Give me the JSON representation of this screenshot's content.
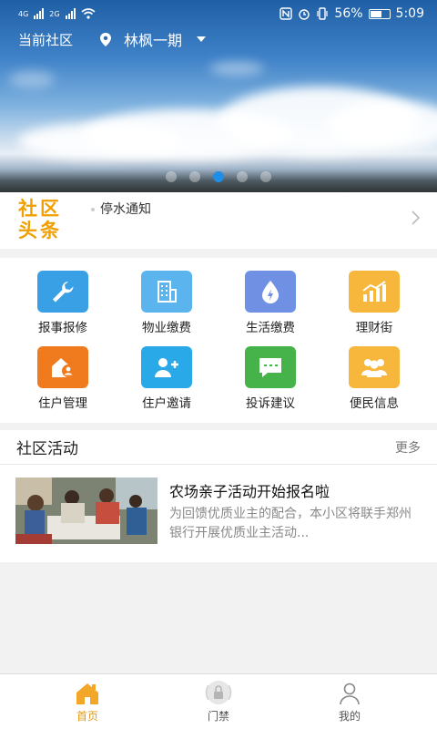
{
  "status_bar": {
    "network_left_1": "4G",
    "network_left_2": "2G",
    "battery_percent": "56%",
    "time": "5:09"
  },
  "header": {
    "community_label": "当前社区",
    "location": "林枫一期"
  },
  "banner": {
    "slide_count": 5,
    "active_slide": 3
  },
  "headline": {
    "logo_line1": "社区",
    "logo_line2": "头条",
    "notice": "停水通知"
  },
  "services": [
    {
      "label": "报事报修",
      "color": "#3aa0e6",
      "icon": "wrench-icon"
    },
    {
      "label": "物业缴费",
      "color": "#5cb4ee",
      "icon": "building-icon"
    },
    {
      "label": "生活缴费",
      "color": "#6f90e3",
      "icon": "utility-drop-icon"
    },
    {
      "label": "理财街",
      "color": "#f6b73c",
      "icon": "bar-chart-icon"
    },
    {
      "label": "住户管理",
      "color": "#f07a1e",
      "icon": "house-user-icon"
    },
    {
      "label": "住户邀请",
      "color": "#2aa9e8",
      "icon": "add-user-icon"
    },
    {
      "label": "投诉建议",
      "color": "#45b24a",
      "icon": "chat-icon"
    },
    {
      "label": "便民信息",
      "color": "#f6b73c",
      "icon": "people-icon"
    }
  ],
  "activity": {
    "section_title": "社区活动",
    "more_label": "更多",
    "item": {
      "title": "农场亲子活动开始报名啦",
      "description": "为回馈优质业主的配合，本小区将联手郑州银行开展优质业主活动..."
    }
  },
  "tabs": [
    {
      "label": "首页",
      "icon": "home-icon",
      "active": true
    },
    {
      "label": "门禁",
      "icon": "lock-icon",
      "active": false
    },
    {
      "label": "我的",
      "icon": "profile-icon",
      "active": false
    }
  ],
  "colors": {
    "accent": "#e39b15",
    "banner_dot_active": "#1e8ee6",
    "logo": "#f0a000"
  }
}
